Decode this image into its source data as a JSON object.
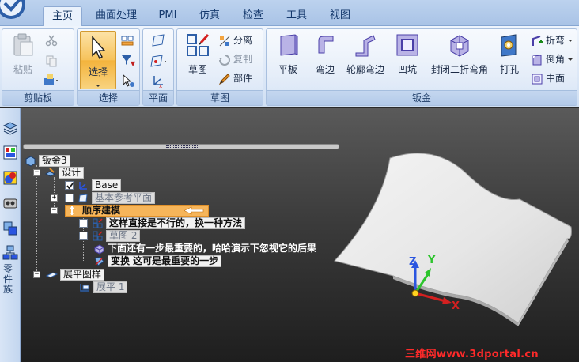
{
  "tabs": [
    "主页",
    "曲面处理",
    "PMI",
    "仿真",
    "检查",
    "工具",
    "视图"
  ],
  "groups": {
    "clipboard": {
      "label": "剪贴板",
      "paste": "粘贴"
    },
    "select": {
      "label": "选择",
      "select": "选择"
    },
    "plane": {
      "label": "平面"
    },
    "sketch": {
      "label": "草图",
      "sketch": "草图",
      "split": "分离",
      "copy": "复制",
      "part": "部件"
    },
    "sheetmetal": {
      "label": "钣金",
      "flat": "平板",
      "bend": "弯边",
      "contour": "轮廓弯边",
      "dimple": "凹坑",
      "closed_corner": "封闭二折弯角",
      "hole": "打孔",
      "fold": "折弯",
      "chamfer": "倒角",
      "middle": "中面"
    }
  },
  "sidebar": {
    "vertical_label": "零件族"
  },
  "tree": {
    "root": "钣金3",
    "design": "设计",
    "base": "Base",
    "ref_planes": "基本参考平面",
    "seq_model": "顺序建模",
    "item1": "这样直接是不行的，换一种方法",
    "sketch2": "草图 2",
    "item3": "下面还有一步最重要的，哈哈演示下忽视它的后果",
    "transform": "变换 这可是最重要的一步",
    "unfold": "展平图样",
    "unfold1": "展平 1"
  },
  "triad": {
    "x": "X",
    "y": "Y",
    "z": "Z"
  },
  "watermark": "三维网www.3dportal.cn",
  "colors": {
    "accent": "#f6b55a",
    "watermark": "#ff2a2a",
    "axis_x": "#d42020",
    "axis_y": "#2cc42c",
    "axis_z": "#2a55e0"
  }
}
